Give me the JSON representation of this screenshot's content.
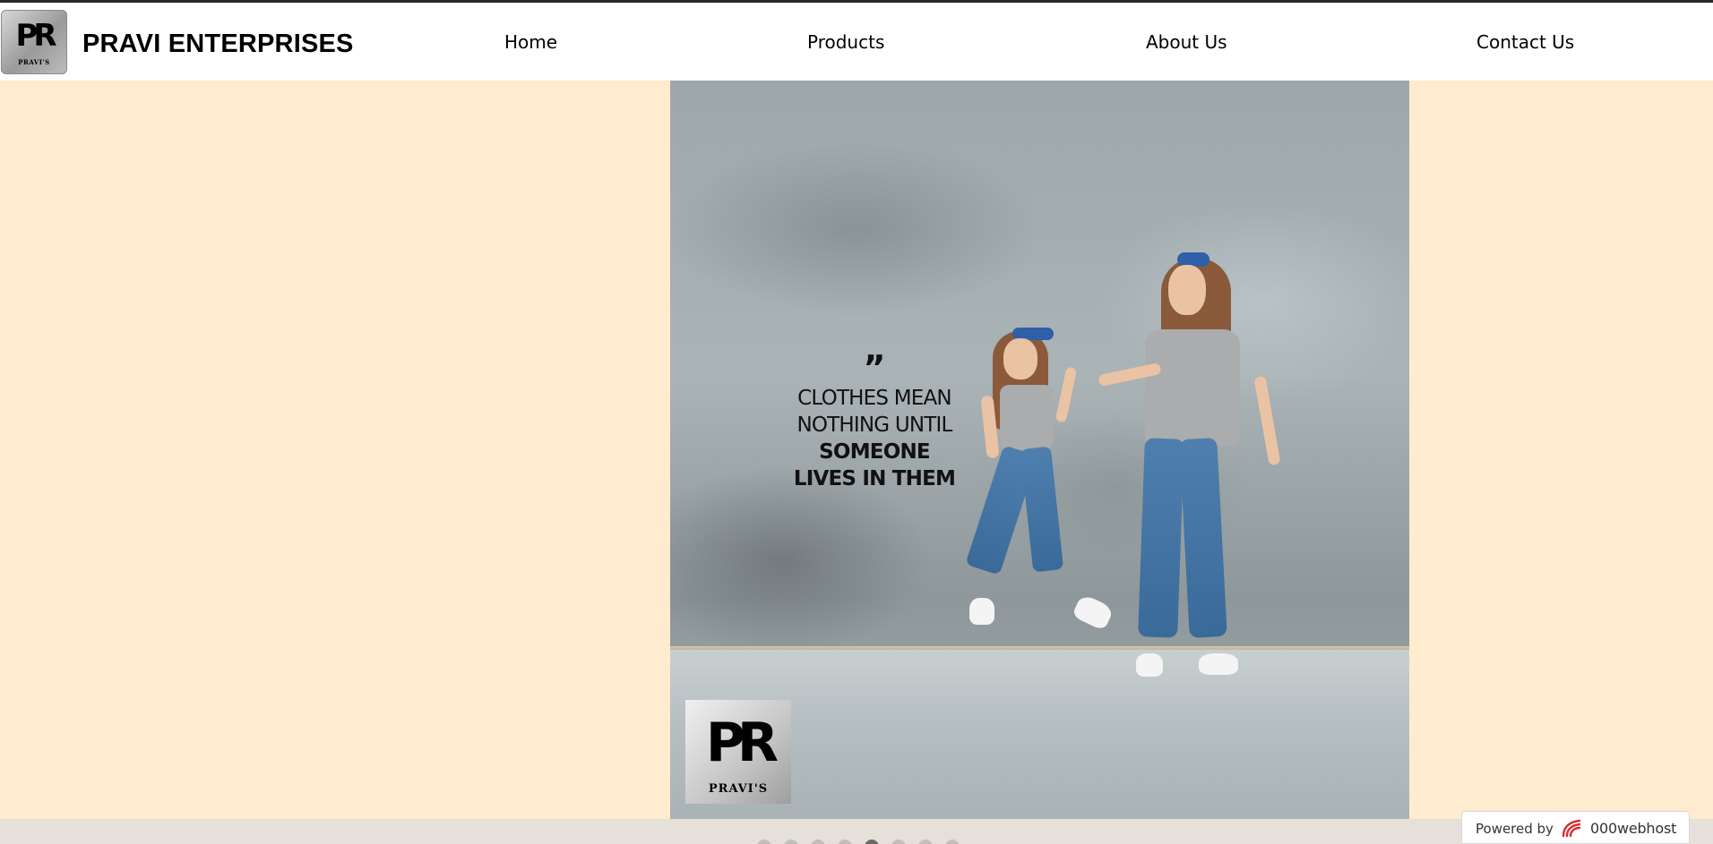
{
  "header": {
    "brand": "PRAVI ENTERPRISES",
    "logo": {
      "mark": "PR",
      "sub": "PRAVI'S"
    }
  },
  "nav": [
    {
      "label": "Home"
    },
    {
      "label": "Products"
    },
    {
      "label": "About Us"
    },
    {
      "label": "Contact Us"
    }
  ],
  "hero": {
    "quote_mark": "”",
    "quote_lines": [
      "CLOTHES MEAN",
      "NOTHING UNTIL",
      "SOMEONE",
      "LIVES IN THEM"
    ],
    "logo": {
      "mark": "PR",
      "sub": "PRAVI'S"
    }
  },
  "carousel": {
    "dot_count": 8,
    "active_index": 4
  },
  "footer_badge": {
    "powered_by": "Powered by",
    "host": "000webhost",
    "icon": "000webhost-logo-icon"
  },
  "colors": {
    "page_background": "#ffebcd",
    "header_background": "#ffffff",
    "accent_red": "#d32f2f"
  }
}
